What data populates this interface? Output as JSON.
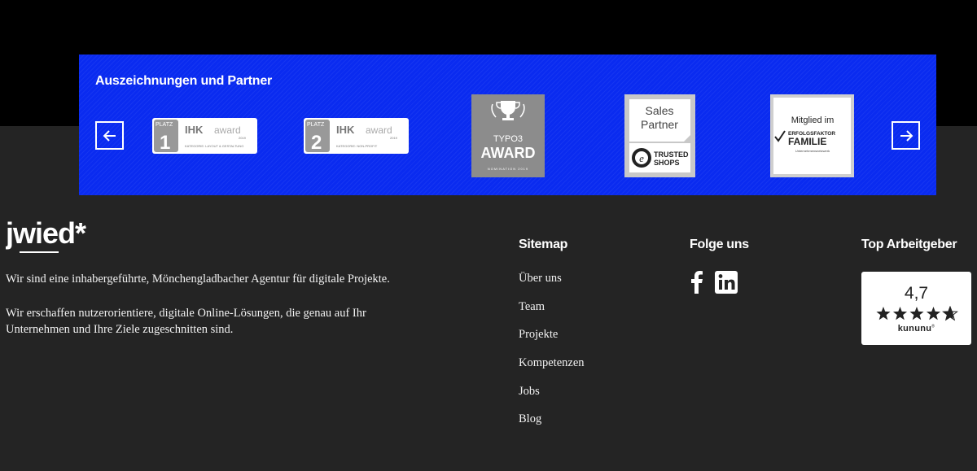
{
  "awards": {
    "title": "Auszeichnungen und Partner",
    "prev_icon": "arrow-left-icon",
    "next_icon": "arrow-right-icon",
    "items": [
      {
        "platz": "PLATZ",
        "number": "1",
        "brand": "IHK",
        "award": "award",
        "year": "2019",
        "category": "KATEGORIE: LAYOUT & GESTALTUNG"
      },
      {
        "platz": "PLATZ",
        "number": "2",
        "brand": "IHK",
        "award": "award",
        "year": "2019",
        "category": "KATEGORIE: NON-PROFIT"
      },
      {
        "line1": "TYPO3",
        "line2": "AWARD",
        "line3": "NOMINATION 2019"
      },
      {
        "line1": "Sales",
        "line2": "Partner",
        "line3": "TRUSTED",
        "line4": "SHOPS",
        "mark": "e"
      },
      {
        "line1": "Mitglied im",
        "line2": "ERFOLGSFAKTOR",
        "line3": "FAMILIE",
        "line4": "Unternehmensnetzwerk"
      }
    ]
  },
  "brand": {
    "logo": "jwied*"
  },
  "about": {
    "p1": "Wir sind eine inhabergeführte, Mönchengladbacher Agentur für digitale Projekte.",
    "p2": "Wir erschaffen nutzerorientiere, digitale Online-Lösungen, die genau auf Ihr Unternehmen und Ihre Ziele zugeschnitten sind."
  },
  "sitemap": {
    "heading": "Sitemap",
    "links": [
      "Über uns",
      "Team",
      "Projekte",
      "Kompetenzen",
      "Jobs",
      "Blog"
    ]
  },
  "follow": {
    "heading": "Folge uns",
    "icons": [
      "facebook-icon",
      "linkedin-icon"
    ]
  },
  "employer": {
    "heading": "Top Arbeitgeber",
    "score": "4,7",
    "rating": 4.7,
    "max_rating": 5,
    "name": "kununu",
    "trademark": "®"
  },
  "colors": {
    "panel": "#0a2bf0",
    "footer": "#242424",
    "top": "#000000"
  }
}
